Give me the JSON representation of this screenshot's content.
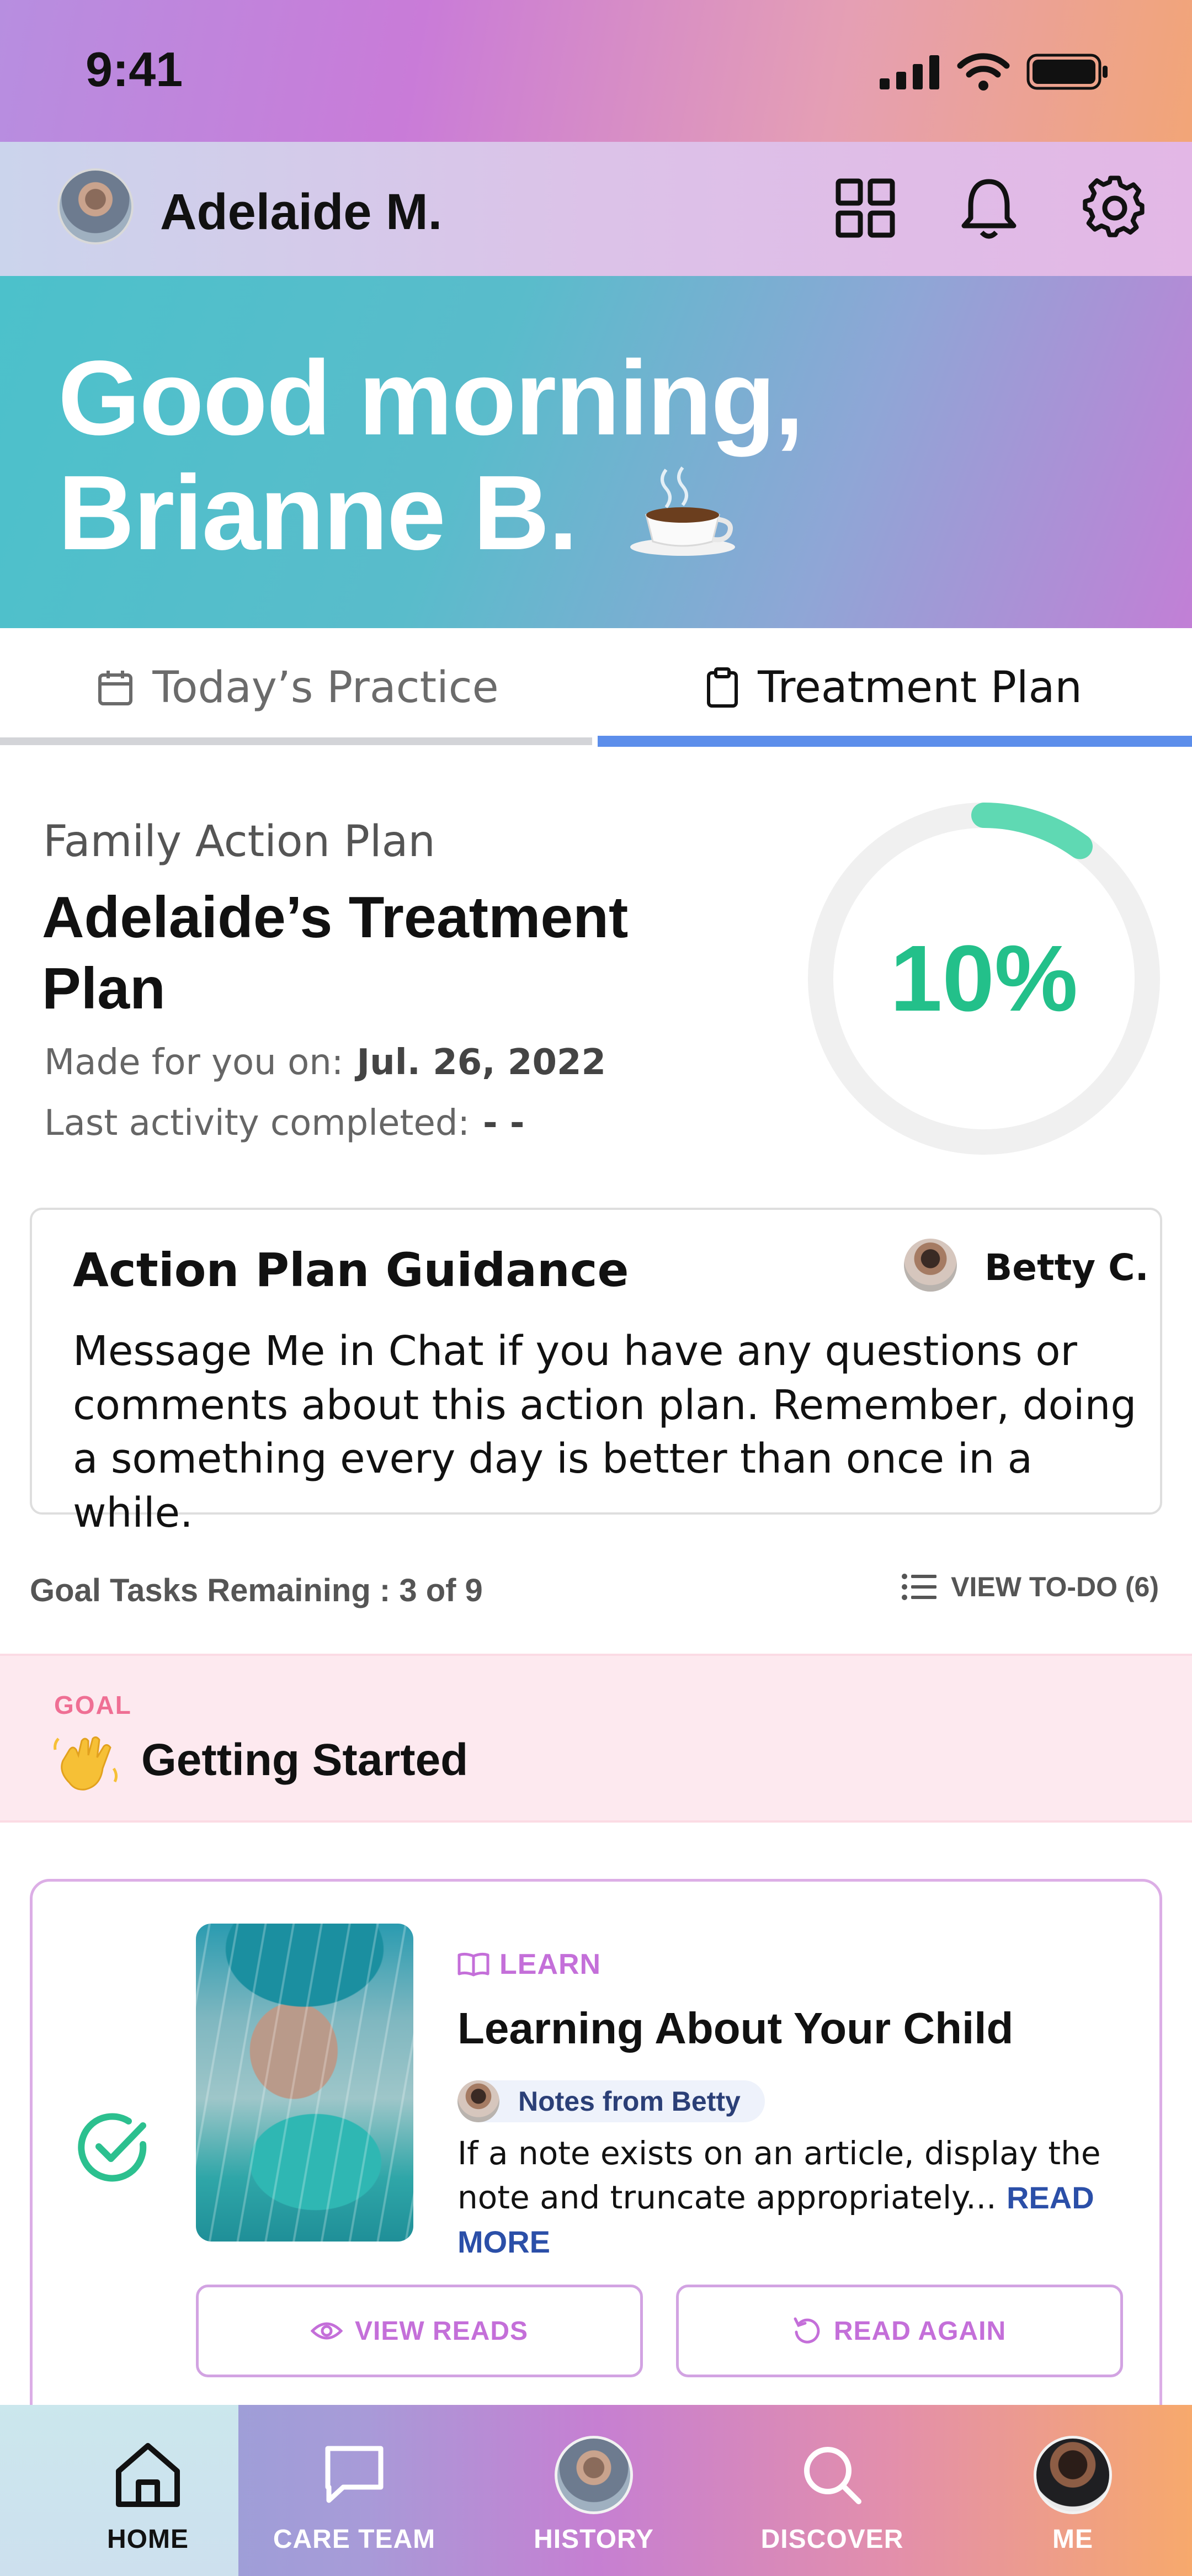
{
  "status_bar": {
    "time": "9:41"
  },
  "header": {
    "child_name": "Adelaide M."
  },
  "hero": {
    "greeting_line1": "Good morning,",
    "greeting_line2": "Brianne B."
  },
  "tabs": [
    {
      "label": "Today’s Practice",
      "active": false
    },
    {
      "label": "Treatment Plan",
      "active": true
    }
  ],
  "plan": {
    "eyebrow": "Family Action Plan",
    "title": "Adelaide’s Treatment Plan",
    "made_label": "Made for you on:",
    "made_date": "Jul. 26, 2022",
    "last_label": "Last activity completed:",
    "last_value": "- -",
    "progress_text": "10%",
    "progress_value": 0.1
  },
  "guidance": {
    "title": "Action Plan Guidance",
    "author": "Betty C.",
    "body": "Message Me in Chat     if you have any questions or comments about this action plan. Remember, doing a something every day is better than once in a while."
  },
  "tasks": {
    "remaining": "Goal Tasks Remaining : 3 of 9",
    "view_todo": "VIEW TO-DO (6)"
  },
  "goal": {
    "label": "GOAL",
    "title": "Getting Started"
  },
  "learn_card": {
    "tag": "LEARN",
    "title": "Learning About Your Child",
    "notes_label": "Notes from Betty",
    "body": "If a note exists on an article, display the note and truncate appropriately...",
    "read_more": "READ MORE",
    "view_reads": "VIEW READS",
    "read_again": "READ AGAIN",
    "completed": true
  },
  "bottom_nav": [
    {
      "label": "HOME",
      "icon": "home-icon",
      "active": true
    },
    {
      "label": "CARE TEAM",
      "icon": "chat-icon",
      "active": false
    },
    {
      "label": "HISTORY",
      "icon": "child-avatar",
      "active": false
    },
    {
      "label": "DISCOVER",
      "icon": "search-icon",
      "active": false
    },
    {
      "label": "ME",
      "icon": "profile-avatar",
      "active": false
    }
  ],
  "colors": {
    "accent_teal": "#23c08a",
    "tab_active": "#5c8eeb",
    "learn_purple": "#c46fd9",
    "goal_pink": "#ef6f94",
    "read_more_blue": "#2b4fa8"
  }
}
